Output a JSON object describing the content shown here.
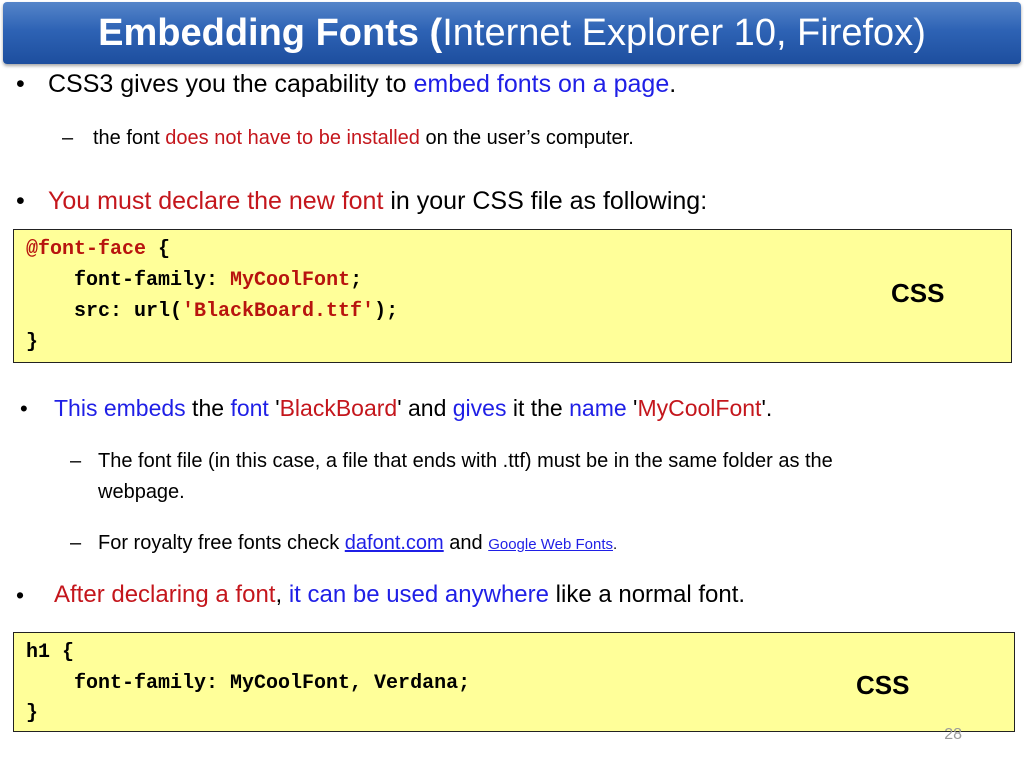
{
  "title": {
    "bold": "Embedding Fonts (",
    "normal": "Internet Explorer 10, Firefox)"
  },
  "bullet1": {
    "prefix": "CSS3 gives you the capability to ",
    "highlight": "embed fonts on a page",
    "suffix": "."
  },
  "sub1": {
    "prefix": "the font ",
    "highlight": "does not have to be installed",
    "suffix": " on the user’s computer."
  },
  "bullet2": {
    "highlight": "You must declare the new font",
    "suffix": " in your CSS file as following:"
  },
  "code1": {
    "l1_kw": "@font-face",
    "l1_rest": " {",
    "l2_prop": "    font-family: ",
    "l2_val": "MyCoolFont",
    "l2_end": ";",
    "l3_prop": "    src: url(",
    "l3_val": "'BlackBoard.ttf'",
    "l3_end": ");",
    "l4": "}",
    "label": "CSS"
  },
  "bullet3": {
    "p1": "This embeds",
    "p2": " the ",
    "p3": "font",
    "p4": " '",
    "p5": "BlackBoard",
    "p6": "' and ",
    "p7": "gives",
    "p8": " it the ",
    "p9": "name",
    "p10": " '",
    "p11": "MyCoolFont",
    "p12": "'."
  },
  "sub2": {
    "line1": "The font file (in this case, a file that ends with .ttf) must be in the same folder as the",
    "line2": "webpage."
  },
  "sub3": {
    "prefix": "For royalty free fonts check ",
    "link1": "dafont.com",
    "mid": " and ",
    "link2": "Google Web Fonts",
    "suffix": "."
  },
  "bullet4": {
    "p1": "After declaring a font",
    "p2": ", ",
    "p3": "it can be used anywhere",
    "p4": " like a normal font."
  },
  "code2": {
    "l1": "h1 {",
    "l2": "    font-family: MyCoolFont, Verdana;",
    "l3": "}",
    "label": "CSS"
  },
  "bullet_char": "•",
  "dash_char": "–",
  "page_number": "28",
  "colors": {
    "title_bg": "#2e63b5",
    "highlight_blue": "#1f1fe6",
    "highlight_red": "#c4161c",
    "code_bg": "#ffff99"
  }
}
